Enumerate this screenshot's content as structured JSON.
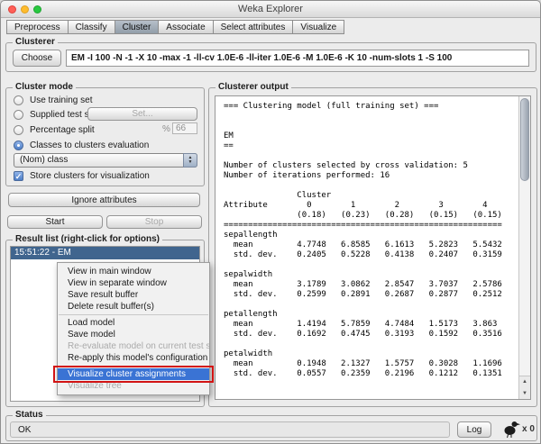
{
  "window": {
    "title": "Weka Explorer"
  },
  "tabs": [
    {
      "label": "Preprocess",
      "active": false
    },
    {
      "label": "Classify",
      "active": false
    },
    {
      "label": "Cluster",
      "active": true
    },
    {
      "label": "Associate",
      "active": false
    },
    {
      "label": "Select attributes",
      "active": false
    },
    {
      "label": "Visualize",
      "active": false
    }
  ],
  "clusterer": {
    "group_label": "Clusterer",
    "choose_button": "Choose",
    "command": "EM -I 100 -N -1 -X 10 -max -1 -ll-cv 1.0E-6 -ll-iter 1.0E-6 -M 1.0E-6 -K 10 -num-slots 1 -S 100"
  },
  "cluster_mode": {
    "group_label": "Cluster mode",
    "use_training_set": {
      "label": "Use training set",
      "selected": false
    },
    "supplied_test_set": {
      "label": "Supplied test set",
      "selected": false,
      "set_button": "Set..."
    },
    "percentage_split": {
      "label": "Percentage split",
      "selected": false,
      "percent_sign": "%",
      "value": "66"
    },
    "classes_to_clusters": {
      "label": "Classes to clusters evaluation",
      "selected": true
    },
    "class_select": {
      "value": "(Nom) class"
    },
    "store_clusters": {
      "label": "Store clusters for visualization",
      "checked": true
    },
    "ignore_attributes_button": "Ignore attributes"
  },
  "run_controls": {
    "start_button": "Start",
    "stop_button": "Stop",
    "stop_enabled": false
  },
  "result_list": {
    "group_label": "Result list (right-click for options)",
    "items": [
      {
        "label": "15:51:22 - EM",
        "selected": true
      }
    ]
  },
  "context_menu": {
    "items": [
      {
        "label": "View in main window",
        "enabled": true
      },
      {
        "label": "View in separate window",
        "enabled": true
      },
      {
        "label": "Save result buffer",
        "enabled": true
      },
      {
        "label": "Delete result buffer(s)",
        "enabled": true
      },
      {
        "label": "Load model",
        "enabled": true
      },
      {
        "label": "Save model",
        "enabled": true
      },
      {
        "label": "Re-evaluate model on current test set",
        "enabled": false
      },
      {
        "label": "Re-apply this model's configuration",
        "enabled": true
      },
      {
        "label": "Visualize cluster assignments",
        "enabled": true,
        "highlighted": true,
        "annotated": true
      },
      {
        "label": "Visualize tree",
        "enabled": false
      }
    ],
    "annotation_color": "#d21414"
  },
  "clusterer_output": {
    "group_label": "Clusterer output",
    "lines": [
      "=== Clustering model (full training set) ===",
      "",
      "",
      "EM",
      "==",
      "",
      "Number of clusters selected by cross validation: 5",
      "Number of iterations performed: 16",
      "",
      "               Cluster",
      "Attribute        0        1        2        3        4",
      "               (0.18)   (0.23)   (0.28)   (0.15)   (0.15)",
      "=========================================================",
      "sepallength",
      "  mean         4.7748   6.8585   6.1613   5.2823   5.5432",
      "  std. dev.    0.2405   0.5228   0.4138   0.2407   0.3159",
      "",
      "sepalwidth",
      "  mean         3.1789   3.0862   2.8547   3.7037   2.5786",
      "  std. dev.    0.2599   0.2891   0.2687   0.2877   0.2512",
      "",
      "petallength",
      "  mean         1.4194   5.7859   4.7484   1.5173   3.863",
      "  std. dev.    0.1692   0.4745   0.3193   0.1592   0.3516",
      "",
      "petalwidth",
      "  mean         0.1948   2.1327   1.5757   0.3028   1.1696",
      "  std. dev.    0.0557   0.2359   0.2196   0.1212   0.1351"
    ]
  },
  "status": {
    "group_label": "Status",
    "message": "OK",
    "log_button": "Log",
    "weka_counter": "x 0"
  },
  "icons": {
    "check": "✓",
    "combo_up": "▲",
    "combo_down": "▼",
    "scroll_up": "▲",
    "scroll_down": "▼"
  },
  "colors": {
    "selection_blue": "#40658e",
    "menu_highlight": "#3a73d4",
    "annotation_red": "#d21414",
    "traffic_red": "#ff5f57",
    "traffic_yellow": "#febc2e",
    "traffic_green": "#28c840"
  }
}
